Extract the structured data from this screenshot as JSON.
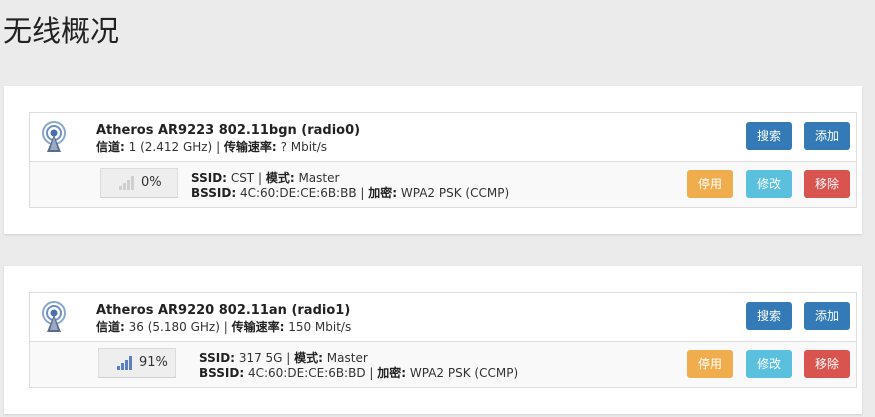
{
  "page": {
    "title": "无线概况"
  },
  "radios": [
    {
      "title": "Atheros AR9223 802.11bgn (radio0)",
      "channel_label": "信道:",
      "channel_value": "1 (2.412 GHz)",
      "rate_label": "传输速率:",
      "rate_value": "? Mbit/s",
      "scan_label": "搜索",
      "add_label": "添加",
      "network": {
        "signal": "0%",
        "signal_level": 0,
        "ssid_label": "SSID:",
        "ssid": "CST",
        "mode_label": "模式:",
        "mode": "Master",
        "bssid_label": "BSSID:",
        "bssid": "4C:60:DE:CE:6B:BB",
        "enc_label": "加密:",
        "encryption": "WPA2 PSK (CCMP)",
        "disable_label": "停用",
        "edit_label": "修改",
        "remove_label": "移除"
      }
    },
    {
      "title": "Atheros AR9220 802.11an (radio1)",
      "channel_label": "信道:",
      "channel_value": "36 (5.180 GHz)",
      "rate_label": "传输速率:",
      "rate_value": "150 Mbit/s",
      "scan_label": "搜索",
      "add_label": "添加",
      "network": {
        "signal": "91%",
        "signal_level": 0.91,
        "ssid_label": "SSID:",
        "ssid": "317 5G",
        "mode_label": "模式:",
        "mode": "Master",
        "bssid_label": "BSSID:",
        "bssid": "4C:60:DE:CE:6B:BD",
        "enc_label": "加密:",
        "encryption": "WPA2 PSK (CCMP)",
        "disable_label": "停用",
        "edit_label": "修改",
        "remove_label": "移除"
      }
    }
  ],
  "colors": {
    "primary": "#337ab7",
    "warning": "#f0ad4e",
    "info": "#5bc0de",
    "danger": "#d9534f",
    "signal_active": "#5b7fc0",
    "signal_inactive": "#cfcfcf"
  }
}
